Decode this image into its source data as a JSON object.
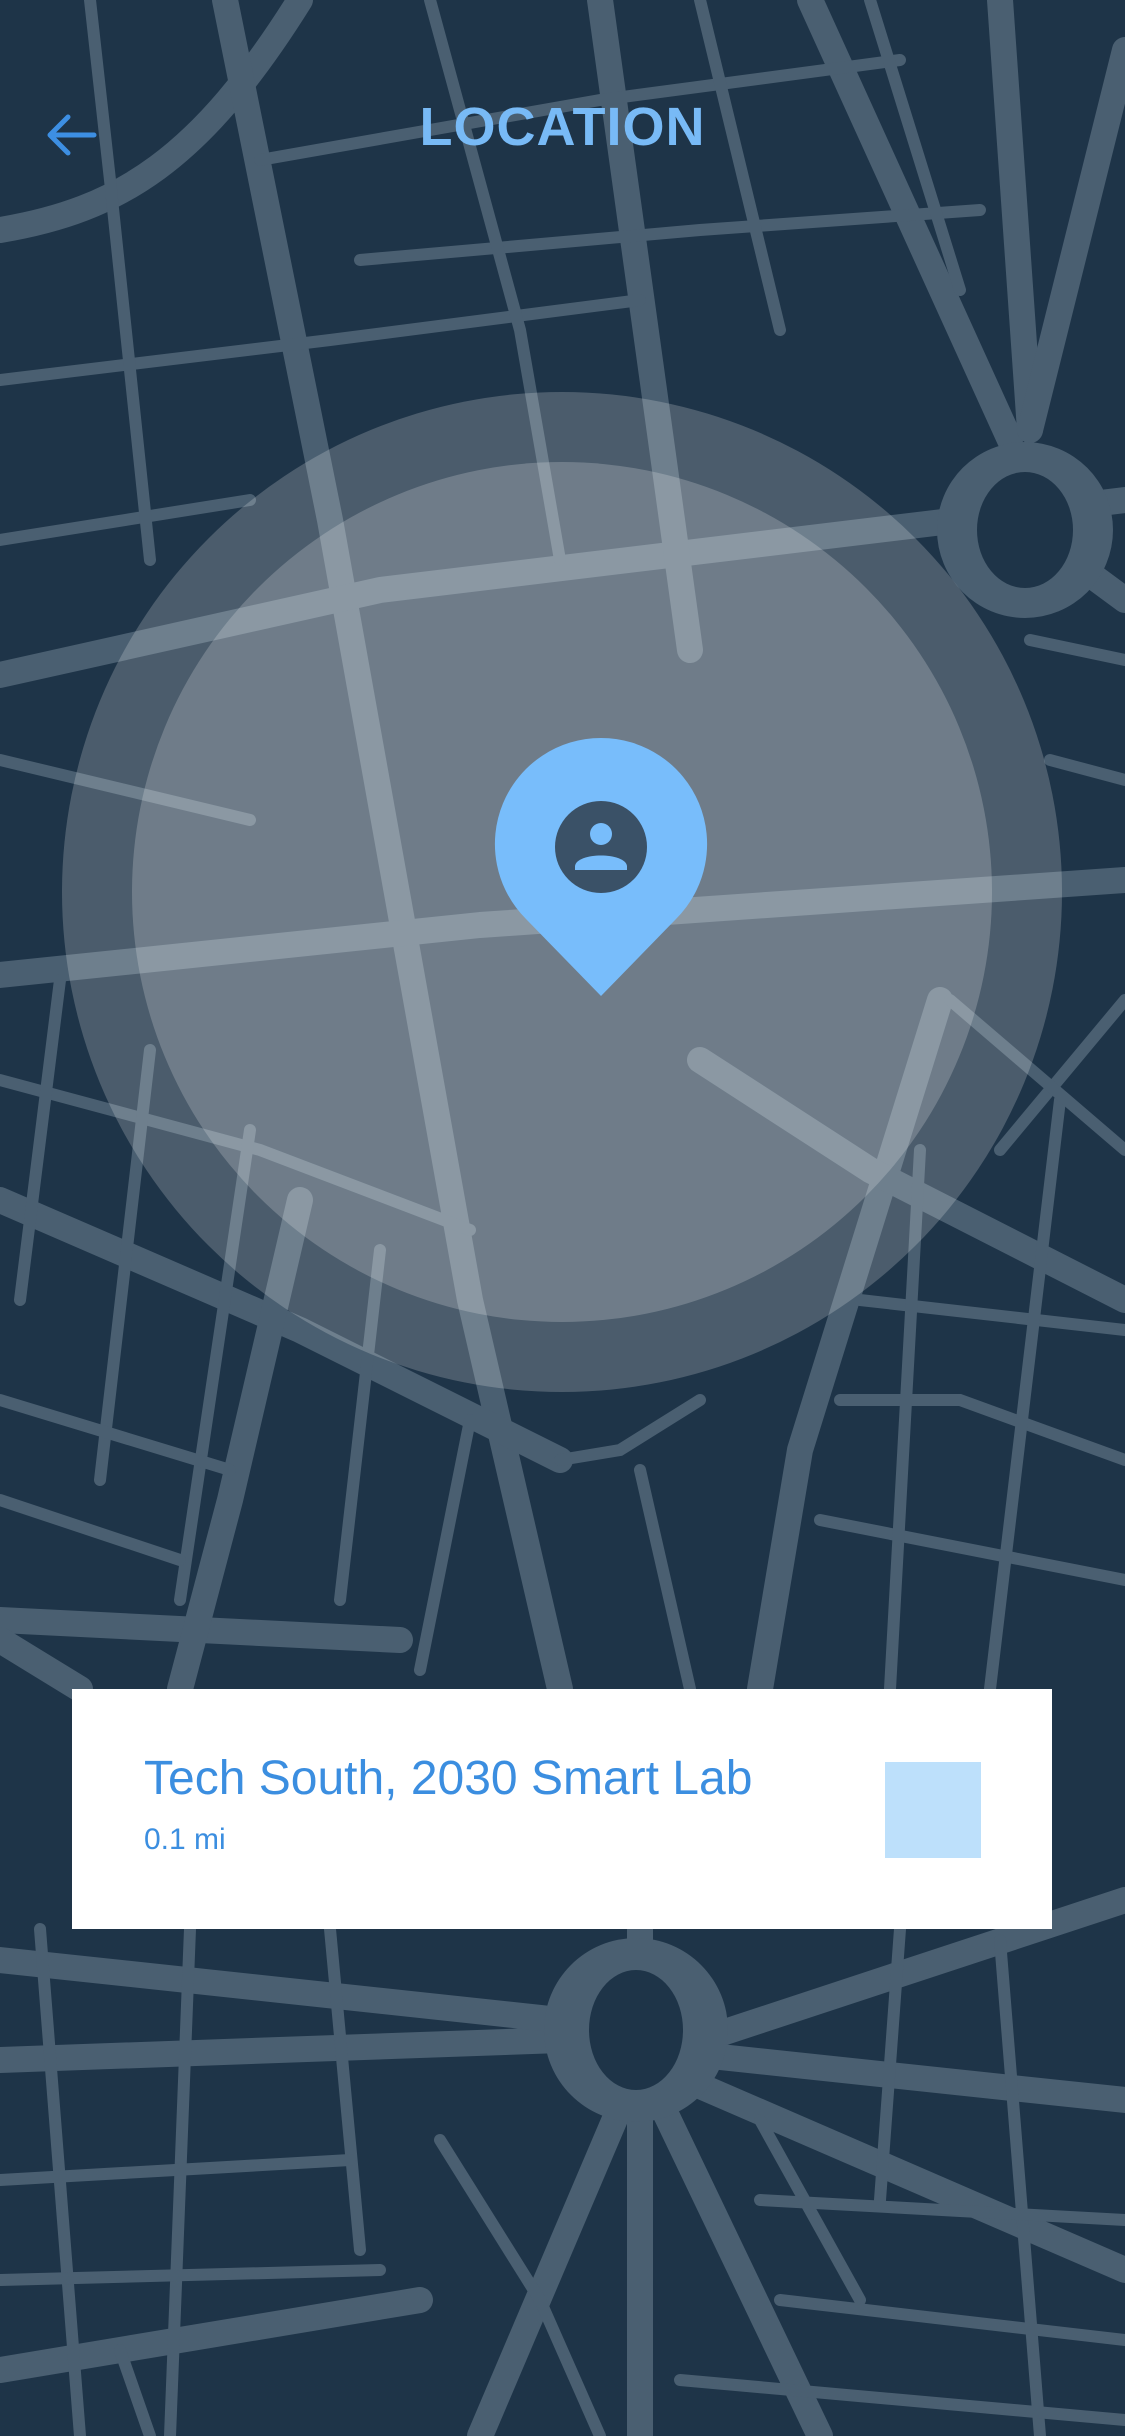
{
  "header": {
    "title": "LOCATION",
    "back_icon": "arrow-left-icon"
  },
  "map": {
    "view": "street map, dark style",
    "search_radius_visible": true,
    "pin_icon": "map-pin-person-icon",
    "colors": {
      "land": "#1e3448",
      "road": "#4a5f71",
      "radius_fill": "#ffffff",
      "pin": "#78bdfb",
      "pin_person": "#3a5167"
    }
  },
  "result_card": {
    "name": "Tech South, 2030 Smart Lab",
    "distance": "0.1 mi",
    "thumbnail_color": "#bde0fb"
  },
  "colors": {
    "accent": "#3b8ee0",
    "title": "#78baf6"
  }
}
